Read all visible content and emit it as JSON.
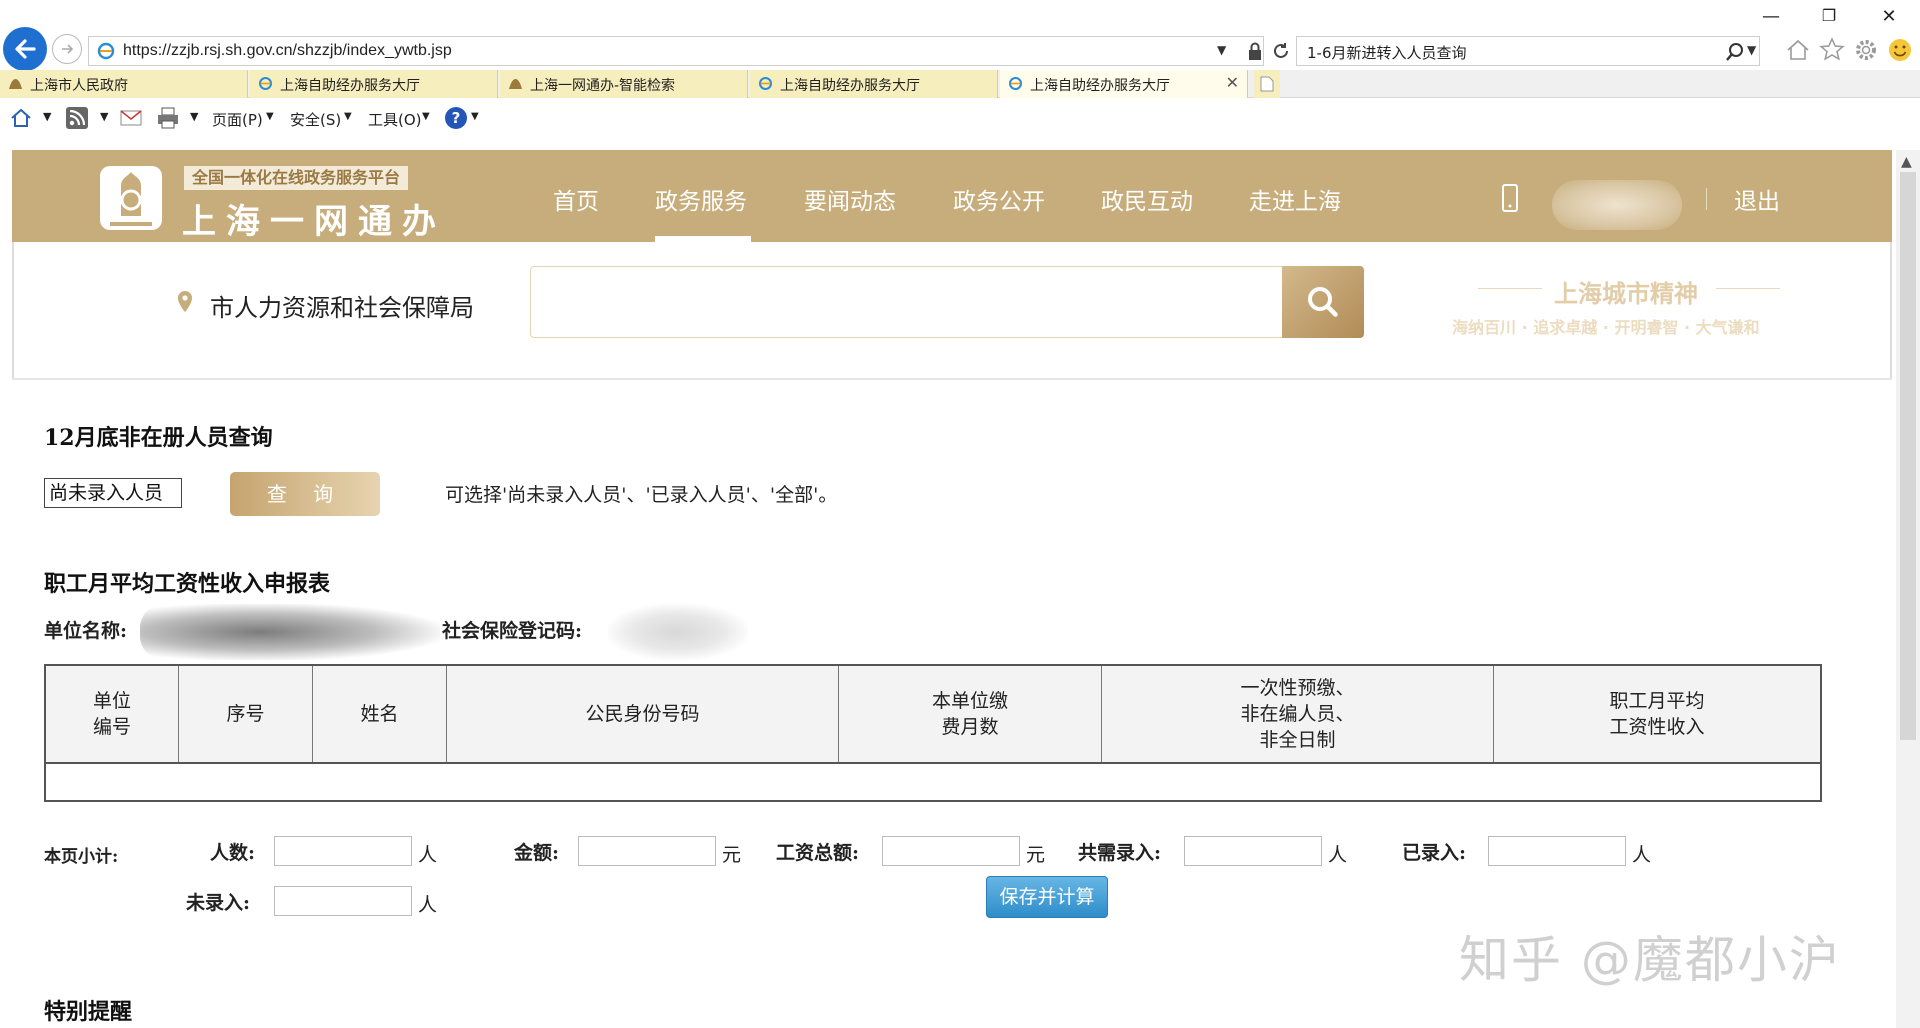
{
  "browser": {
    "url": "https://zzjb.rsj.sh.gov.cn/shzzjb/index_ywtb.jsp",
    "search_query": "1-6月新进转入人员查询",
    "tabs": [
      {
        "label": "上海市人民政府"
      },
      {
        "label": "上海自助经办服务大厅"
      },
      {
        "label": "上海一网通办-智能检索"
      },
      {
        "label": "上海自助经办服务大厅"
      },
      {
        "label": "上海自助经办服务大厅",
        "active": true
      }
    ],
    "tab_close": "✕",
    "commands": {
      "page": "页面(P)",
      "safety": "安全(S)",
      "tools": "工具(O)"
    }
  },
  "site": {
    "logo_sub": "全国一体化在线政务服务平台",
    "logo_main": "上海一网通办",
    "nav": [
      "首页",
      "政务服务",
      "要闻动态",
      "政务公开",
      "政民互动",
      "走进上海"
    ],
    "active_nav_index": 1,
    "logout": "退出",
    "department": "市人力资源和社会保障局",
    "slogan_title": "上海城市精神",
    "slogan_sub": "海纳百川 · 追求卓越 · 开明睿智 · 大气谦和",
    "brand_color": "#c6ad7b"
  },
  "query": {
    "title": "12月底非在册人员查询",
    "select_value": "尚未录入人员",
    "button": "查 询",
    "hint": "可选择'尚未录入人员'、'已录入人员'、'全部'。"
  },
  "report": {
    "title": "职工月平均工资性收入申报表",
    "unit_name_label": "单位名称:",
    "social_code_label": "社会保险登记码:",
    "columns": [
      "单位\n编号",
      "序号",
      "姓名",
      "公民身份号码",
      "本单位缴\n费月数",
      "一次性预缴、\n非在编人员、\n非全日制",
      "职工月平均\n工资性收入"
    ]
  },
  "subtotal": {
    "label": "本页小计:",
    "people_label": "人数:",
    "amount_label": "金额:",
    "wage_total_label": "工资总额:",
    "need_label": "共需录入:",
    "entered_label": "已录入:",
    "not_entered_label": "未录入:",
    "unit_person": "人",
    "unit_yuan": "元",
    "save_button": "保存并计算"
  },
  "notice": {
    "title": "特别提醒"
  },
  "watermark": "知乎 @魔都小沪"
}
